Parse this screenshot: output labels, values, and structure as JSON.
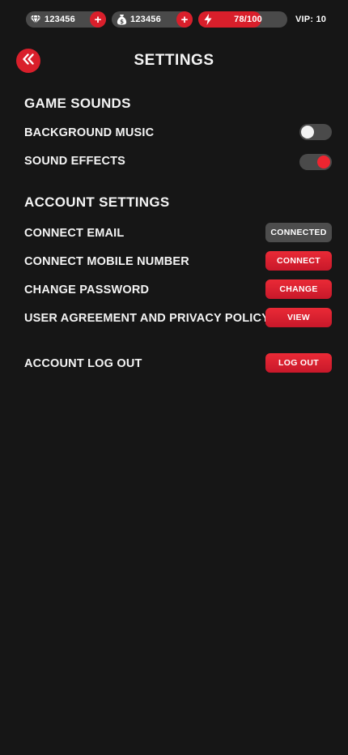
{
  "top_bar": {
    "gems": "123456",
    "money": "123456",
    "energy": "78/100",
    "energy_fraction": 0.71,
    "plus_symbol": "+",
    "vip": "VIP: 10"
  },
  "header": {
    "back_symbol": "«",
    "title": "SETTINGS"
  },
  "game_sounds": {
    "title": "GAME SOUNDS",
    "background_music": {
      "label": "BACKGROUND MUSIC",
      "enabled": false
    },
    "sound_effects": {
      "label": "SOUND EFFECTS",
      "enabled": true
    }
  },
  "account_settings": {
    "title": "ACCOUNT SETTINGS",
    "connect_email": {
      "label": "CONNECT EMAIL",
      "button": "CONNECTED"
    },
    "connect_mobile": {
      "label": "CONNECT MOBILE NUMBER",
      "button": "CONNECT"
    },
    "change_password": {
      "label": "CHANGE PASSWORD",
      "button": "CHANGE"
    },
    "user_agreement": {
      "label": "USER AGREEMENT AND PRIVACY POLICY",
      "button": "VIEW"
    },
    "log_out": {
      "label": "ACCOUNT LOG OUT",
      "button": "LOG OUT"
    }
  },
  "colors": {
    "background": "#161616",
    "accent": "#d91f2b",
    "pill": "#4a4a4a",
    "text": "#f4f4f4"
  },
  "icons": {
    "gems": "diamond-icon",
    "money": "money-bag-icon",
    "energy": "lightning-icon",
    "back": "double-chevron-left-icon"
  }
}
